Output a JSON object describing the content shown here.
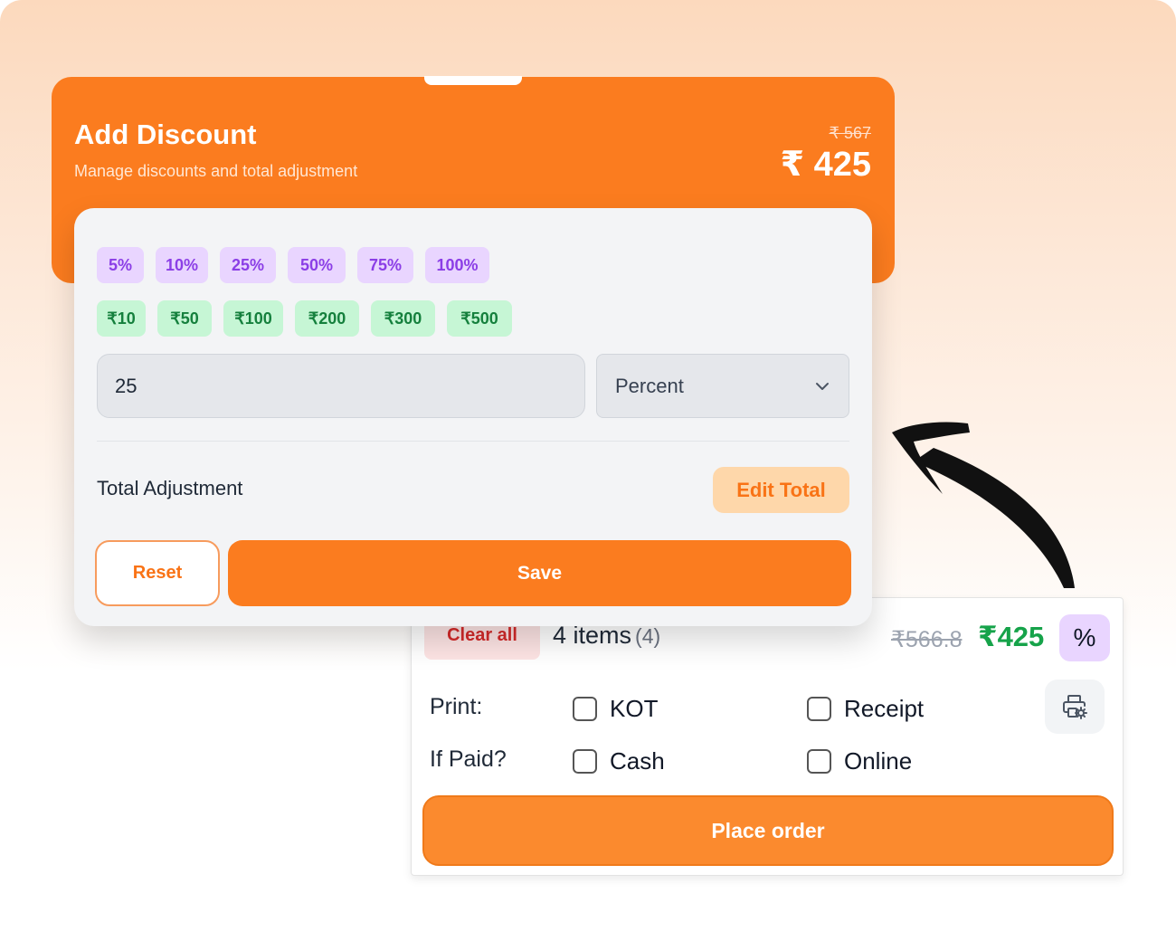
{
  "discount_modal": {
    "title": "Add Discount",
    "subtitle": "Manage discounts and total adjustment",
    "original_total": "₹ 567",
    "discounted_total": "₹ 425",
    "percent_presets": [
      "5%",
      "10%",
      "25%",
      "50%",
      "75%",
      "100%"
    ],
    "amount_presets": [
      "₹10",
      "₹50",
      "₹100",
      "₹200",
      "₹300",
      "₹500"
    ],
    "discount_value": "25",
    "discount_type": "Percent",
    "total_adjustment_label": "Total Adjustment",
    "edit_total_label": "Edit Total",
    "reset_label": "Reset",
    "save_label": "Save"
  },
  "order_panel": {
    "clear_all_label": "Clear all",
    "items_label": "4 items",
    "items_count": "(4)",
    "original_price": "₹566.8",
    "final_price": "₹425",
    "discount_button_label": "%",
    "print_label": "Print:",
    "print_options": [
      "KOT",
      "Receipt"
    ],
    "paid_label": "If Paid?",
    "payment_options": [
      "Cash",
      "Online"
    ],
    "place_order_label": "Place order"
  },
  "colors": {
    "accent_orange": "#fb7c1f",
    "price_green": "#16a34a",
    "percent_chip": "#e9d5ff",
    "amount_chip": "#c6f6d5",
    "clear_red": "#d42a2a"
  },
  "icons": [
    "chevron-down-icon",
    "printer-settings-icon",
    "curved-arrow-icon"
  ]
}
